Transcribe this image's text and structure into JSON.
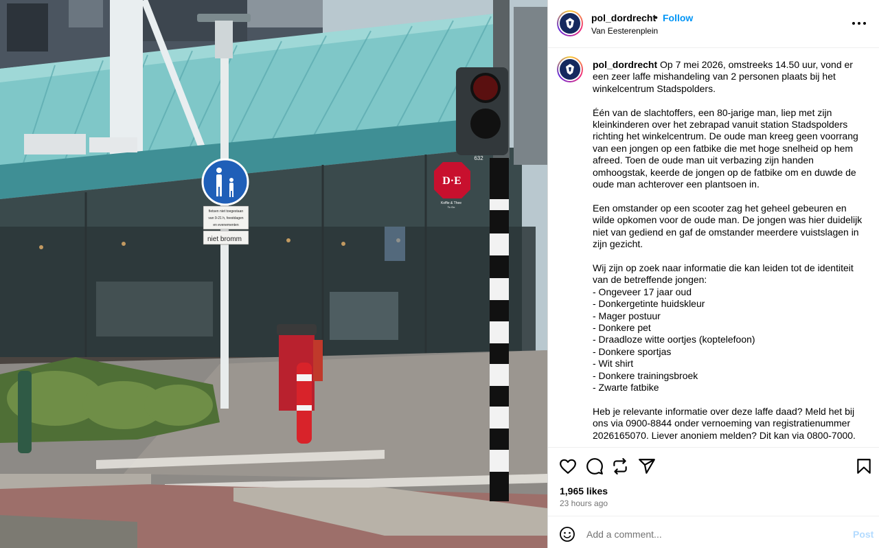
{
  "post": {
    "username": "pol_dordrecht",
    "separator": "•",
    "follow_label": "Follow",
    "location": "Van Eesterenplein"
  },
  "photo": {
    "sign_text_1": "fietsen niet toegestaan",
    "sign_text_2": "van 9-21 h, feestdagen",
    "sign_text_3": "en evenementen",
    "sign_text_4": "niet bromm",
    "store_logo": "D·E",
    "store_sub": "Koffie & Thee",
    "store_sub2": "To Go",
    "light_number": "632"
  },
  "caption": {
    "username": "pol_dordrecht",
    "body": " Op 7 mei 2026, omstreeks 14.50 uur, vond er een zeer laffe mishandeling van 2 personen plaats bij het winkelcentrum Stadspolders.\n\nÉén van de slachtoffers, een 80-jarige man, liep met zijn kleinkinderen over het zebrapad vanuit station Stadspolders richting het winkelcentrum. De oude man kreeg geen voorrang van een jongen op een fatbike die met hoge snelheid op hem afreed. Toen de oude man uit verbazing zijn handen omhoogstak, keerde de jongen op de fatbike om en duwde de oude man achterover een plantsoen in.\n\nEen omstander op een scooter zag het geheel gebeuren en wilde opkomen voor de oude man. De jongen was hier duidelijk niet van gediend en gaf de omstander meerdere vuistslagen in zijn gezicht.\n\nWij zijn op zoek naar informatie die kan leiden tot de identiteit van de betreffende jongen:\n- Ongeveer 17 jaar oud\n- Donkergetinte huidskleur\n- Mager postuur\n- Donkere pet\n- Draadloze witte oortjes (koptelefoon)\n- Donkere sportjas\n- Wit shirt\n- Donkere trainingsbroek\n- Zwarte fatbike\n\nHeb je relevante informatie over deze laffe daad? Meld het bij ons via 0900-8844 onder vernoeming van registratienummer 2026165070. Liever anoniem melden? Dit kan via 0800-7000."
  },
  "stats": {
    "likes": "1,965 likes",
    "time_ago": "23 hours ago"
  },
  "comment": {
    "placeholder": "Add a comment...",
    "post_label": "Post"
  },
  "icons": {
    "more": "more-options-icon",
    "like": "heart-icon",
    "comment": "comment-icon",
    "repost": "repost-icon",
    "share": "share-icon",
    "save": "bookmark-icon",
    "emoji": "emoji-icon"
  },
  "colors": {
    "follow": "#0095f6",
    "post_disabled": "#b3dbff",
    "muted": "#737373",
    "police_blue": "#15295e"
  }
}
